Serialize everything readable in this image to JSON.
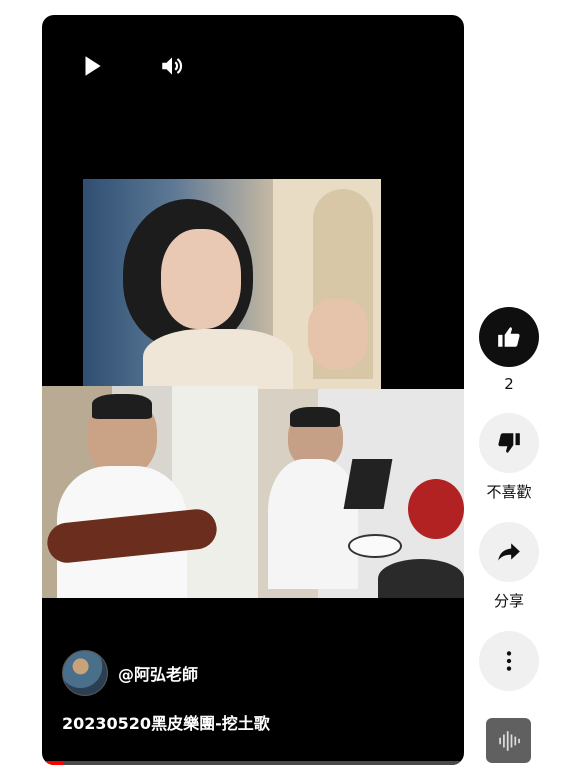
{
  "player": {
    "controls": {
      "play_icon": "play-icon",
      "volume_icon": "volume-icon"
    },
    "progress_fraction": 0.05
  },
  "video": {
    "channel": {
      "name": "@阿弘老師"
    },
    "title": "20230520黑皮樂團-挖土歌"
  },
  "actions": {
    "like": {
      "count": "2",
      "icon": "thumbs-up-icon"
    },
    "dislike": {
      "label": "不喜歡",
      "icon": "thumbs-down-icon"
    },
    "share": {
      "label": "分享",
      "icon": "share-arrow-icon"
    },
    "more": {
      "icon": "more-vertical-icon"
    },
    "sound": {
      "icon": "sound-wave-icon"
    }
  },
  "colors": {
    "accent": "#ff0000",
    "player_bg": "#000000",
    "button_bg": "#f0f0f0"
  }
}
